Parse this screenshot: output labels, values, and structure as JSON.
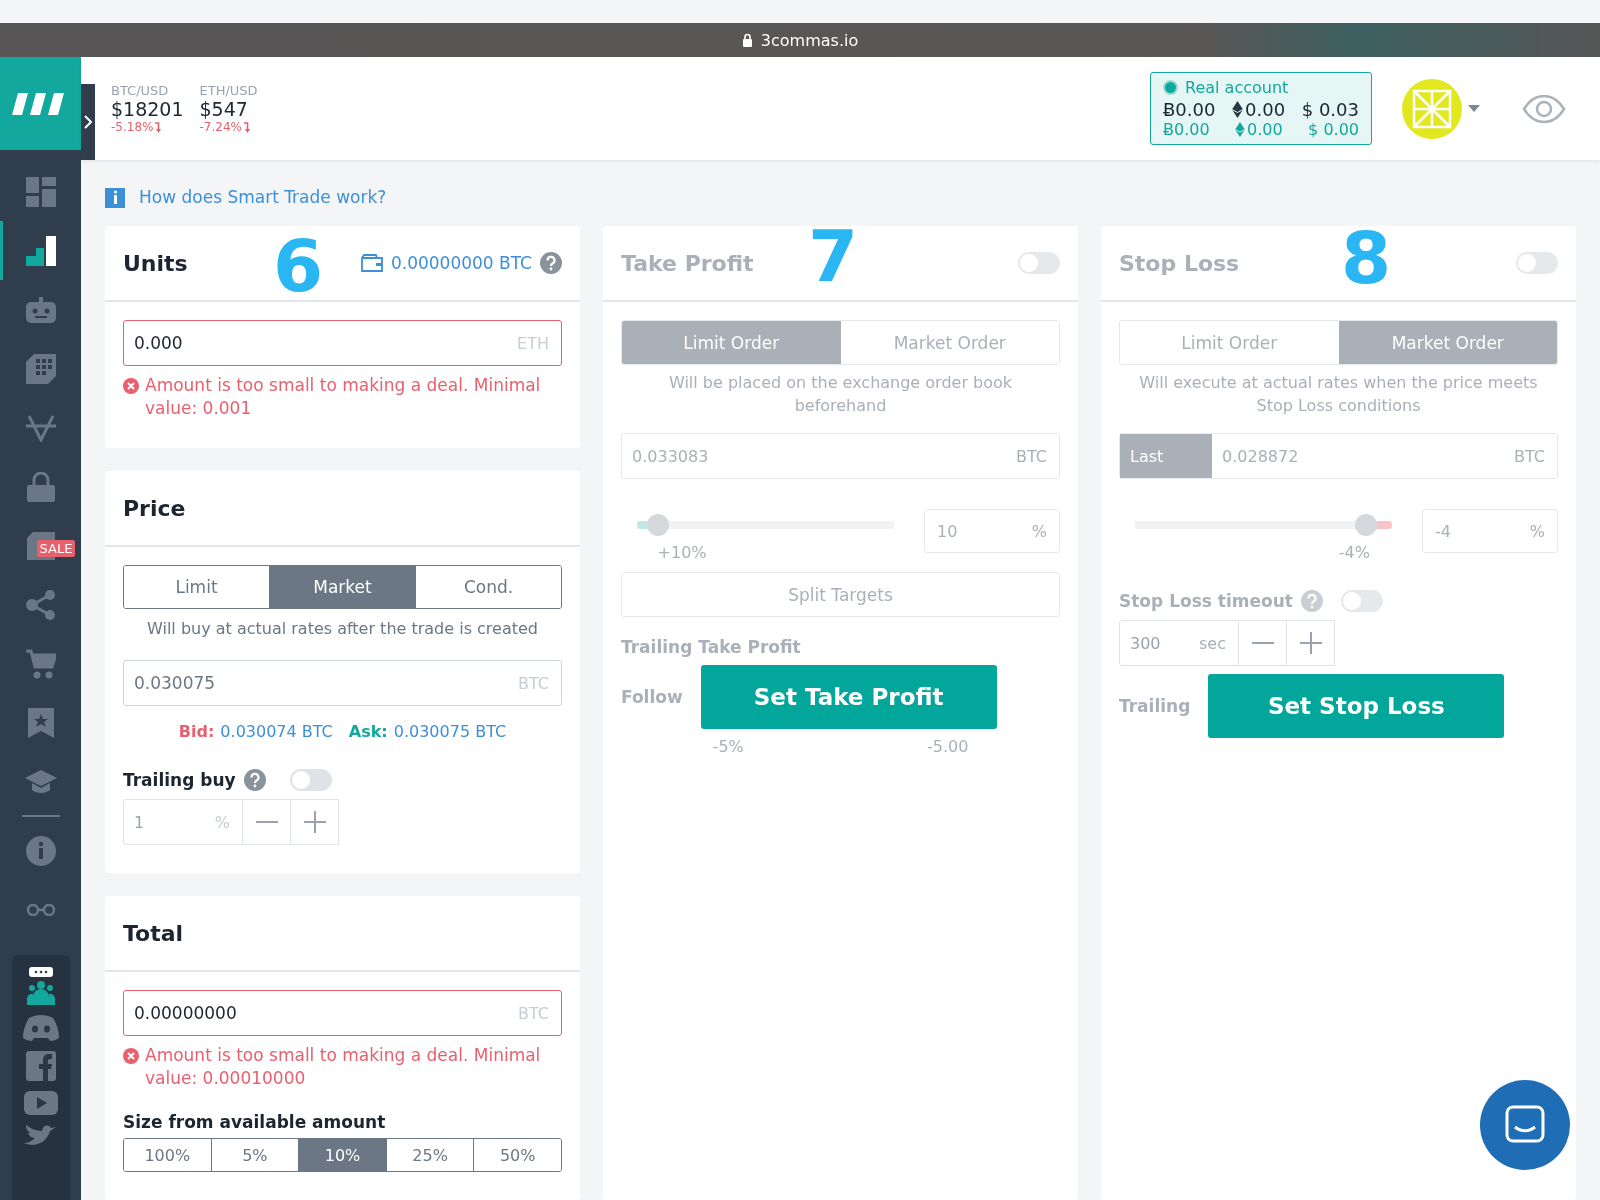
{
  "browser": {
    "url": "3commas.io"
  },
  "sidebar": {
    "items": [
      {
        "kind": "panels",
        "selected": false
      },
      {
        "kind": "bars",
        "selected": true
      },
      {
        "kind": "robot",
        "selected": false
      },
      {
        "kind": "grid",
        "selected": false
      },
      {
        "kind": "vee",
        "selected": false
      },
      {
        "kind": "lock",
        "selected": false
      },
      {
        "kind": "tag",
        "selected": false,
        "badge": "SALE"
      },
      {
        "kind": "share",
        "selected": false
      },
      {
        "kind": "cart",
        "selected": false
      },
      {
        "kind": "bookmark",
        "selected": false
      },
      {
        "kind": "cap",
        "selected": false
      },
      {
        "kind": "info",
        "selected": false
      },
      {
        "kind": "glasses",
        "selected": false
      }
    ],
    "social": [
      {
        "kind": "chat"
      },
      {
        "kind": "discord"
      },
      {
        "kind": "facebook"
      },
      {
        "kind": "youtube"
      },
      {
        "kind": "bird"
      }
    ]
  },
  "tickers": [
    {
      "pair": "BTC/USD",
      "price": "$18201",
      "change": "-5.18%"
    },
    {
      "pair": "ETH/USD",
      "price": "$547",
      "change": "-7.24%"
    }
  ],
  "account": {
    "label": "Real account",
    "balances": [
      {
        "kind": "btc",
        "amount": "Ƀ0.00"
      },
      {
        "kind": "eth",
        "amount": "0.00"
      },
      {
        "kind": "usd",
        "amount": "$ 0.03"
      }
    ],
    "reserved": [
      {
        "kind": "btc",
        "amount": "Ƀ0.00"
      },
      {
        "kind": "eth",
        "amount": "0.00"
      },
      {
        "kind": "usd",
        "amount": "$ 0.00"
      }
    ]
  },
  "help_link": "How does Smart Trade work?",
  "units": {
    "title": "Units",
    "marker": "6",
    "wallet": "0.00000000 BTC",
    "value": "0.000",
    "suffix": "ETH",
    "invalid": true,
    "error": "Amount is too small to making a deal. Minimal value: 0.001"
  },
  "price": {
    "title": "Price",
    "tabs": [
      {
        "label": "Limit",
        "selected": false
      },
      {
        "label": "Market",
        "selected": true
      },
      {
        "label": "Cond.",
        "selected": false
      }
    ],
    "note": "Will buy at actual rates after the trade is created",
    "value": "0.030075",
    "suffix": "BTC",
    "bid_label": "Bid:",
    "bid": "0.030074 BTC",
    "ask_label": "Ask:",
    "ask": "0.030075 BTC",
    "trailing": {
      "label": "Trailing buy",
      "on": false,
      "value": "1",
      "unit": "%"
    }
  },
  "total": {
    "title": "Total",
    "value": "0.00000000",
    "suffix": "BTC",
    "invalid": true,
    "error": "Amount is too small to making a deal. Minimal value: 0.00010000",
    "size_label": "Size from available amount",
    "sizes": [
      {
        "label": "100%",
        "selected": false
      },
      {
        "label": "5%",
        "selected": false
      },
      {
        "label": "10%",
        "selected": true
      },
      {
        "label": "25%",
        "selected": false
      },
      {
        "label": "50%",
        "selected": false
      }
    ]
  },
  "take_profit": {
    "title": "Take Profit",
    "marker": "7",
    "enabled": false,
    "tabs": [
      {
        "label": "Limit Order",
        "selected": true
      },
      {
        "label": "Market Order",
        "selected": false
      }
    ],
    "note": "Will be placed on the exchange order book beforehand",
    "price": "0.033083",
    "suffix": "BTC",
    "slider": {
      "level": 0.08,
      "reading": "+10%"
    },
    "percent": "10",
    "percent_unit": "%",
    "split": "Split Targets",
    "trailing_label": "Trailing Take Profit",
    "follow_label": "Follow",
    "follow_reading": "-5%",
    "follow_value": "-5.00",
    "button": "Set Take Profit"
  },
  "stop_loss": {
    "title": "Stop Loss",
    "marker": "8",
    "enabled": false,
    "tabs": [
      {
        "label": "Limit Order",
        "selected": false
      },
      {
        "label": "Market Order",
        "selected": true
      }
    ],
    "note": "Will execute at actual rates when the price meets Stop Loss conditions",
    "select": "Last",
    "price": "0.028872",
    "suffix": "BTC",
    "slider": {
      "level": 0.9,
      "reading": "-4%"
    },
    "percent": "-4",
    "percent_unit": "%",
    "timeout_label": "Stop Loss timeout",
    "timeout_on": false,
    "timeout_value": "300",
    "timeout_unit": "sec",
    "trailing_label": "Trailing",
    "button": "Set Stop Loss"
  }
}
